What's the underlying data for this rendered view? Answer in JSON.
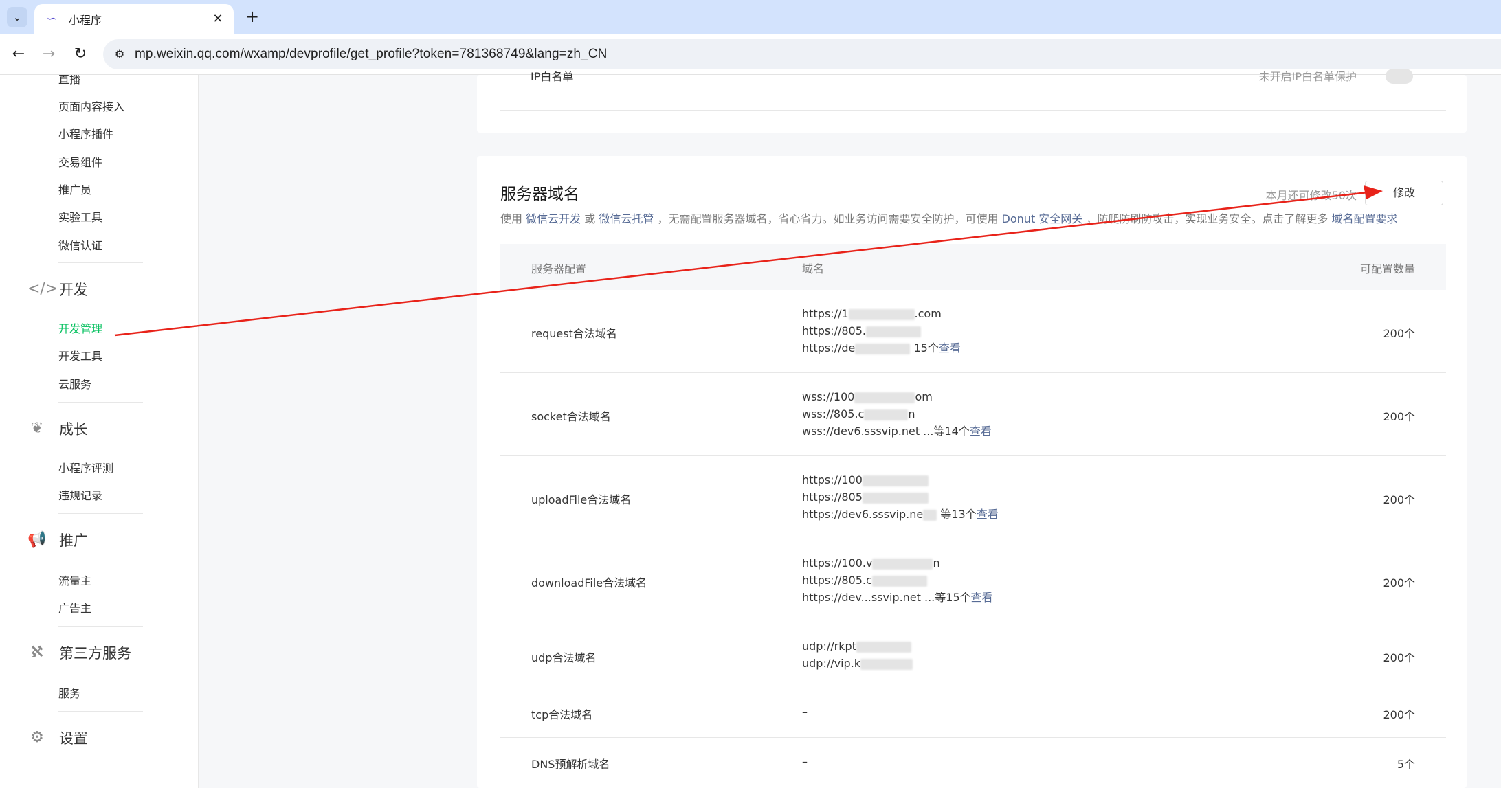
{
  "browser": {
    "tab_title": "小程序",
    "url": "mp.weixin.qq.com/wxamp/devprofile/get_profile?token=781368749&lang=zh_CN"
  },
  "sidebar": {
    "top_items": [
      "直播",
      "页面内容接入",
      "小程序插件",
      "交易组件",
      "推广员",
      "实验工具",
      "微信认证"
    ],
    "groups": [
      {
        "label": "开发",
        "icon": "code-icon",
        "items": [
          "开发管理",
          "开发工具",
          "云服务"
        ]
      },
      {
        "label": "成长",
        "icon": "sprout-icon",
        "items": [
          "小程序评测",
          "违规记录"
        ]
      },
      {
        "label": "推广",
        "icon": "megaphone-icon",
        "items": [
          "流量主",
          "广告主"
        ]
      },
      {
        "label": "第三方服务",
        "icon": "third-party-icon",
        "items": [
          "服务"
        ]
      },
      {
        "label": "设置",
        "icon": "gear-icon",
        "items": []
      }
    ],
    "active_item": "开发管理"
  },
  "top_card": {
    "label": "IP白名单",
    "status": "未开启IP白名单保护"
  },
  "server_domain": {
    "title": "服务器域名",
    "quota": "本月还可修改50次",
    "edit_label": "修改",
    "desc": {
      "p1": "使用",
      "link1": "微信云开发",
      "p2": "或",
      "link2": "微信云托管",
      "p3": "，无需配置服务器域名，省心省力。如业务访问需要安全防护，可使用",
      "link3": "Donut 安全网关",
      "p4": "，防爬防刷防攻击，实现业务安全。点击了解更多",
      "link4": "域名配置要求"
    },
    "headers": {
      "config": "服务器配置",
      "domain": "域名",
      "count": "可配置数量"
    },
    "rows": [
      {
        "name": "request合法域名",
        "lines": [
          "https://1",
          "https://805.",
          "https://de"
        ],
        "more_prefix": "15个",
        "more_link": "查看",
        "count": "200个"
      },
      {
        "name": "socket合法域名",
        "lines": [
          "wss://100",
          "wss://805.c",
          "wss://dev6.sssvip.net ..."
        ],
        "more_prefix": "等14个",
        "more_link": "查看",
        "count": "200个"
      },
      {
        "name": "uploadFile合法域名",
        "lines": [
          "https://100",
          "https://805",
          "https://dev6.sssvip.ne"
        ],
        "more_prefix": "等13个",
        "more_link": "查看",
        "count": "200个"
      },
      {
        "name": "downloadFile合法域名",
        "lines": [
          "https://100.v",
          "https://805.c",
          "https://dev...ssvip.net ..."
        ],
        "more_prefix": "等15个",
        "more_link": "查看",
        "count": "200个"
      },
      {
        "name": "udp合法域名",
        "lines": [
          "udp://rkpt",
          "udp://vip.k"
        ],
        "more_prefix": "",
        "more_link": "",
        "count": "200个"
      },
      {
        "name": "tcp合法域名",
        "lines": [
          "–"
        ],
        "more_prefix": "",
        "more_link": "",
        "count": "200个"
      },
      {
        "name": "DNS预解析域名",
        "lines": [
          "–"
        ],
        "more_prefix": "",
        "more_link": "",
        "count": "5个"
      }
    ]
  },
  "colors": {
    "accent_green": "#07c160",
    "link_blue": "#576b95",
    "annotation_red": "#e8231a"
  }
}
